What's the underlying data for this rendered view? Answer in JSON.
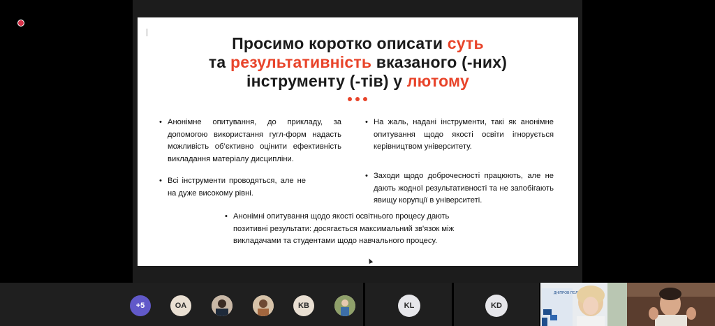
{
  "slide": {
    "title_line1_prefix": "Просимо коротко описати ",
    "title_line1_accent": "суть",
    "title_line2_prefix": "та ",
    "title_line2_accent": "результативність",
    "title_line2_suffix": " вказаного (-них)",
    "title_line3_prefix": "інструменту (-тів) у ",
    "title_line3_accent": "лютому",
    "bullet_mark": "•",
    "bullets": [
      "Анонімне опитування, до прикладу, за допомогою використання гугл-форм надасть можливість об’єктивно оцінити ефективність викладання матеріалу дисципліни.",
      "Всі інструменти проводяться, але не на дуже високому рівні.",
      "На жаль, надані інструменти, такі як анонімне опитування щодо якості освіти ігнорується керівництвом університету.",
      "Заходи щодо доброчесності працюють, але не дають жодної результативності та не запобігають явищу корупції в університеті.",
      "Анонімні опитування щодо якості освітнього процесу дають позитивні результати: досягається максимальний зв'язок між викладачами та студентами щодо навчального процесу."
    ],
    "accent_color": "#e8442a"
  },
  "participants": {
    "more_count": "+5",
    "tiles": [
      {
        "label": "OA",
        "kind": "initials"
      },
      {
        "label": "",
        "kind": "photo"
      },
      {
        "label": "",
        "kind": "photo"
      },
      {
        "label": "KB",
        "kind": "initials"
      },
      {
        "label": "",
        "kind": "photo"
      },
      {
        "label": "KL",
        "kind": "initials"
      },
      {
        "label": "KD",
        "kind": "initials"
      }
    ],
    "video_logo_text": "ДНІПРОВ ПОЛІТЕХ 1899"
  }
}
